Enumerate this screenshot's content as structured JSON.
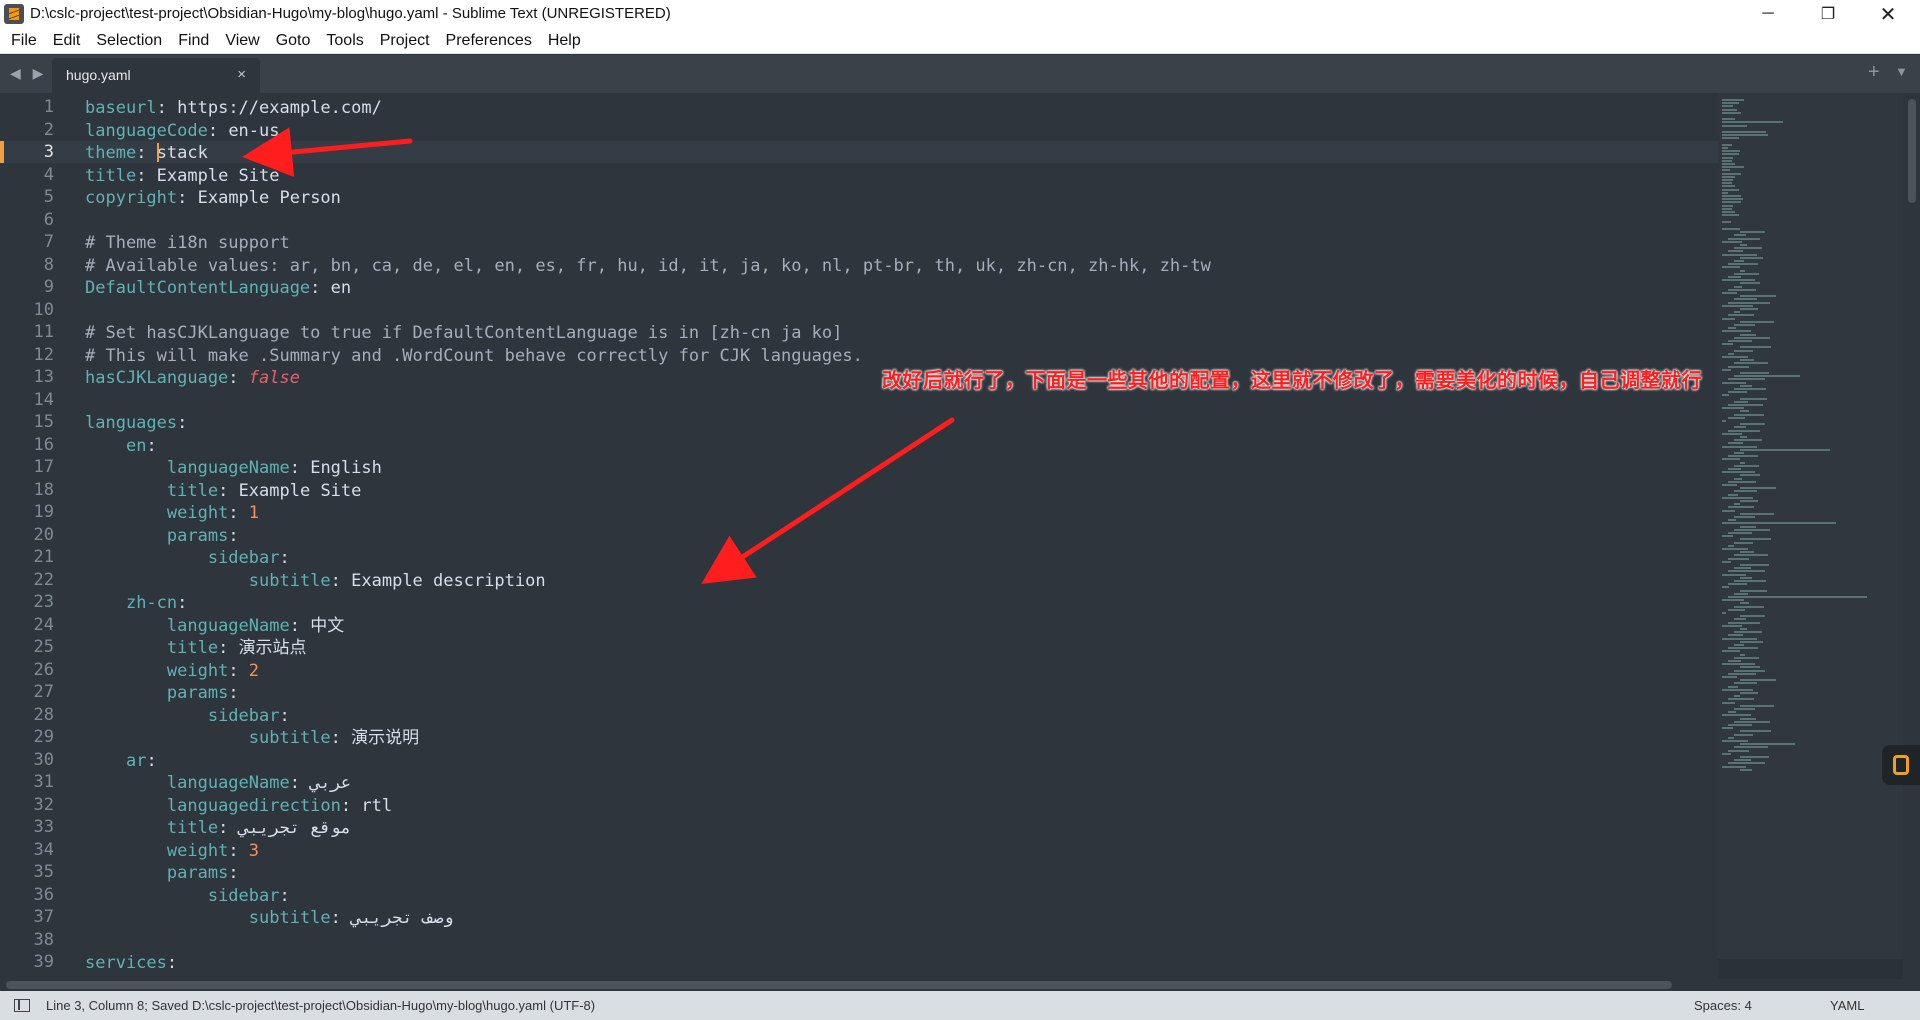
{
  "window": {
    "title": "D:\\cslc-project\\test-project\\Obsidian-Hugo\\my-blog\\hugo.yaml - Sublime Text (UNREGISTERED)",
    "controls": {
      "minimize": "─",
      "maximize": "❐",
      "close": "✕"
    }
  },
  "menu": [
    "File",
    "Edit",
    "Selection",
    "Find",
    "View",
    "Goto",
    "Tools",
    "Project",
    "Preferences",
    "Help"
  ],
  "tabs": {
    "nav": "◀ ▶",
    "active": {
      "label": "hugo.yaml",
      "close": "×"
    },
    "new_tab": "+",
    "dropdown": "▼"
  },
  "editor": {
    "line_numbers": [
      "1",
      "2",
      "3",
      "4",
      "5",
      "6",
      "7",
      "8",
      "9",
      "10",
      "11",
      "12",
      "13",
      "14",
      "15",
      "16",
      "17",
      "18",
      "19",
      "20",
      "21",
      "22",
      "23",
      "24",
      "25",
      "26",
      "27",
      "28",
      "29",
      "30",
      "31",
      "32",
      "33",
      "34",
      "35",
      "36",
      "37",
      "38",
      "39"
    ],
    "active_line": 3,
    "lines": [
      {
        "indent": "",
        "key": "baseurl",
        "value": "https://example.com/",
        "type": "val"
      },
      {
        "indent": "",
        "key": "languageCode",
        "value": "en-us",
        "type": "val"
      },
      {
        "indent": "",
        "key": "theme",
        "value": "stack",
        "type": "val"
      },
      {
        "indent": "",
        "key": "title",
        "value": "Example Site",
        "type": "val"
      },
      {
        "indent": "",
        "key": "copyright",
        "value": "Example Person",
        "type": "val"
      },
      {
        "indent": "",
        "key": "",
        "value": "",
        "type": "blank"
      },
      {
        "indent": "",
        "key": "",
        "value": "# Theme i18n support",
        "type": "cmt"
      },
      {
        "indent": "",
        "key": "",
        "value": "# Available values: ar, bn, ca, de, el, en, es, fr, hu, id, it, ja, ko, nl, pt-br, th, uk, zh-cn, zh-hk, zh-tw",
        "type": "cmt"
      },
      {
        "indent": "",
        "key": "DefaultContentLanguage",
        "value": "en",
        "type": "val"
      },
      {
        "indent": "",
        "key": "",
        "value": "",
        "type": "blank"
      },
      {
        "indent": "",
        "key": "",
        "value": "# Set hasCJKLanguage to true if DefaultContentLanguage is in [zh-cn ja ko]",
        "type": "cmt"
      },
      {
        "indent": "",
        "key": "",
        "value": "# This will make .Summary and .WordCount behave correctly for CJK languages.",
        "type": "cmt"
      },
      {
        "indent": "",
        "key": "hasCJKLanguage",
        "value": "false",
        "type": "bool"
      },
      {
        "indent": "",
        "key": "",
        "value": "",
        "type": "blank"
      },
      {
        "indent": "",
        "key": "languages",
        "value": "",
        "type": "val"
      },
      {
        "indent": "    ",
        "key": "en",
        "value": "",
        "type": "val"
      },
      {
        "indent": "        ",
        "key": "languageName",
        "value": "English",
        "type": "val"
      },
      {
        "indent": "        ",
        "key": "title",
        "value": "Example Site",
        "type": "val"
      },
      {
        "indent": "        ",
        "key": "weight",
        "value": "1",
        "type": "num"
      },
      {
        "indent": "        ",
        "key": "params",
        "value": "",
        "type": "val"
      },
      {
        "indent": "            ",
        "key": "sidebar",
        "value": "",
        "type": "val"
      },
      {
        "indent": "                ",
        "key": "subtitle",
        "value": "Example description",
        "type": "val"
      },
      {
        "indent": "    ",
        "key": "zh-cn",
        "value": "",
        "type": "val"
      },
      {
        "indent": "        ",
        "key": "languageName",
        "value": "中文",
        "type": "val"
      },
      {
        "indent": "        ",
        "key": "title",
        "value": "演示站点",
        "type": "val"
      },
      {
        "indent": "        ",
        "key": "weight",
        "value": "2",
        "type": "num"
      },
      {
        "indent": "        ",
        "key": "params",
        "value": "",
        "type": "val"
      },
      {
        "indent": "            ",
        "key": "sidebar",
        "value": "",
        "type": "val"
      },
      {
        "indent": "                ",
        "key": "subtitle",
        "value": "演示说明",
        "type": "val"
      },
      {
        "indent": "    ",
        "key": "ar",
        "value": "",
        "type": "val"
      },
      {
        "indent": "        ",
        "key": "languageName",
        "value": "عربي",
        "type": "val"
      },
      {
        "indent": "        ",
        "key": "languagedirection",
        "value": "rtl",
        "type": "val"
      },
      {
        "indent": "        ",
        "key": "title",
        "value": "موقع تجريبي",
        "type": "val"
      },
      {
        "indent": "        ",
        "key": "weight",
        "value": "3",
        "type": "num"
      },
      {
        "indent": "        ",
        "key": "params",
        "value": "",
        "type": "val"
      },
      {
        "indent": "            ",
        "key": "sidebar",
        "value": "",
        "type": "val"
      },
      {
        "indent": "                ",
        "key": "subtitle",
        "value": "وصف تجريبي",
        "type": "val"
      },
      {
        "indent": "",
        "key": "",
        "value": "",
        "type": "blank"
      },
      {
        "indent": "",
        "key": "services",
        "value": "",
        "type": "val"
      }
    ]
  },
  "annotation": {
    "text": "改好后就行了，下面是一些其他的配置，这里就不修改了，需要美化的时候，自己调整就行",
    "color": "#ff1e1e"
  },
  "status": {
    "message": "Line 3, Column 8; Saved D:\\cslc-project\\test-project\\Obsidian-Hugo\\my-blog\\hugo.yaml (UTF-8)",
    "spaces": "Spaces: 4",
    "syntax": "YAML"
  },
  "colors": {
    "background": "#2e353d",
    "key": "#5fb3b3",
    "comment": "#a7adba",
    "number": "#f99157",
    "boolean": "#ec5f67",
    "accent": "#f0a040"
  }
}
